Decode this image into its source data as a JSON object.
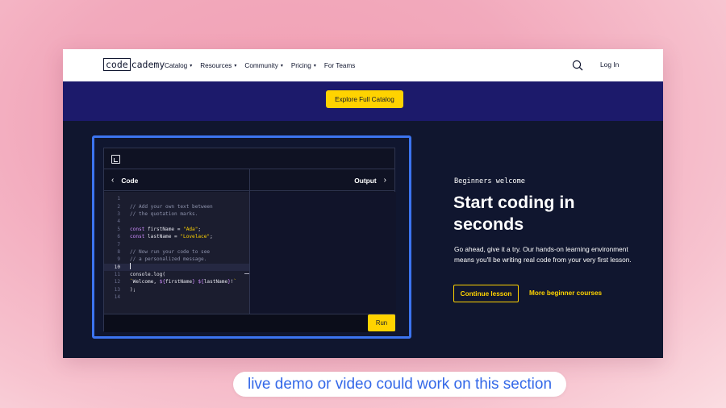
{
  "nav": {
    "logo_box": "code",
    "logo_rest": "cademy",
    "items": [
      {
        "label": "Catalog",
        "caret": "▾"
      },
      {
        "label": "Resources",
        "caret": "▾"
      },
      {
        "label": "Community",
        "caret": "▾"
      },
      {
        "label": "Pricing",
        "caret": "▾"
      },
      {
        "label": "For Teams",
        "caret": ""
      }
    ],
    "login_label": "Log In"
  },
  "banner": {
    "button_label": "Explore Full Catalog"
  },
  "editor": {
    "code_tab_label": "Code",
    "output_tab_label": "Output",
    "back_chevron": "‹",
    "forward_chevron": "›",
    "run_label": "Run",
    "lines": [
      {
        "n": "1",
        "html": ""
      },
      {
        "n": "2",
        "text": "// Add your own text between"
      },
      {
        "n": "3",
        "text": "// the quotation marks."
      },
      {
        "n": "4",
        "text": ""
      },
      {
        "n": "5",
        "text": "const firstName = \"Ada\";"
      },
      {
        "n": "6",
        "text": "const lastName = \"Lovelace\";"
      },
      {
        "n": "7",
        "text": ""
      },
      {
        "n": "8",
        "text": "// Now run your code to see"
      },
      {
        "n": "9",
        "text": "// a personalized message."
      },
      {
        "n": "10",
        "text": ""
      },
      {
        "n": "11",
        "text": "console.log("
      },
      {
        "n": "12",
        "text": "`Welcome, ${firstName} ${lastName}!`"
      },
      {
        "n": "13",
        "text": ");"
      },
      {
        "n": "14",
        "text": ""
      }
    ]
  },
  "hero": {
    "eyebrow": "Beginners welcome",
    "title": "Start coding in seconds",
    "description": "Go ahead, give it a try. Our hands-on learning environment means you'll be writing real code from your very first lesson.",
    "continue_label": "Continue lesson",
    "more_label": "More beginner courses"
  },
  "caption": "live demo or video could work on this section",
  "colors": {
    "accent_yellow": "#ffd300",
    "banner_navy": "#1c1a6b",
    "dark_bg": "#10162f",
    "highlight_blue": "#3c74f0",
    "caption_text": "#3368e8"
  }
}
